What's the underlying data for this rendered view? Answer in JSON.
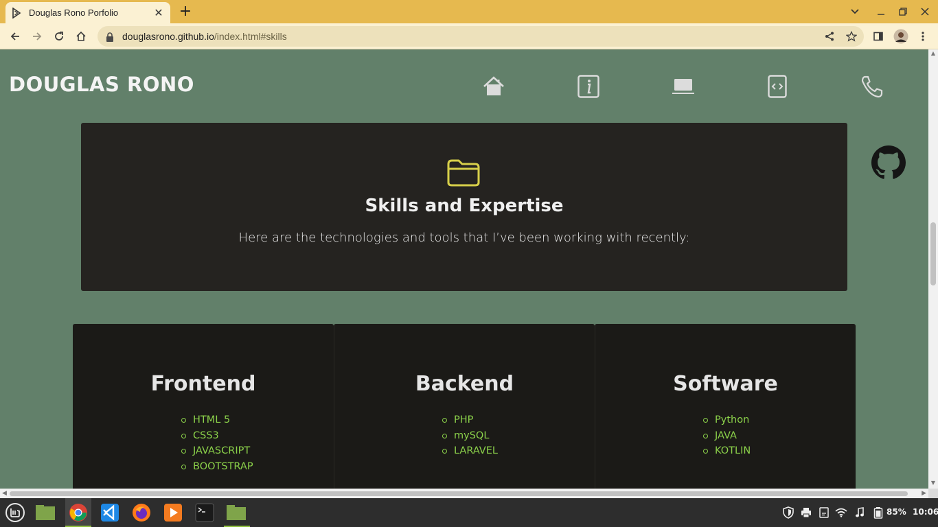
{
  "browser": {
    "tab_title": "Douglas Rono Porfolio",
    "url_host": "douglasrono.github.io",
    "url_path": "/index.html#skills"
  },
  "site": {
    "brand": "DOUGLAS RONO",
    "nav_icons": [
      "home-icon",
      "info-icon",
      "laptop-icon",
      "code-file-icon",
      "phone-icon"
    ]
  },
  "hero": {
    "title": "Skills and Expertise",
    "subtitle": "Here are the technologies and tools that I’ve been working with recently:"
  },
  "skills": {
    "frontend": {
      "title": "Frontend",
      "items": [
        "HTML 5",
        "CSS3",
        "JAVASCRIPT",
        "BOOTSTRAP"
      ]
    },
    "backend": {
      "title": "Backend",
      "items": [
        "PHP",
        "mySQL",
        "LARAVEL"
      ]
    },
    "software": {
      "title": "Software",
      "items": [
        "Python",
        "JAVA",
        "KOTLIN"
      ]
    }
  },
  "taskbar": {
    "battery": "85%",
    "time": "10:06"
  },
  "colors": {
    "tab_strip": "#e6b94f",
    "page_bg": "#62806a",
    "hero_bg": "#252320",
    "card_bg": "#1b1a17",
    "accent_green": "#8bd14a",
    "folder_yellow": "#d8d04a"
  }
}
